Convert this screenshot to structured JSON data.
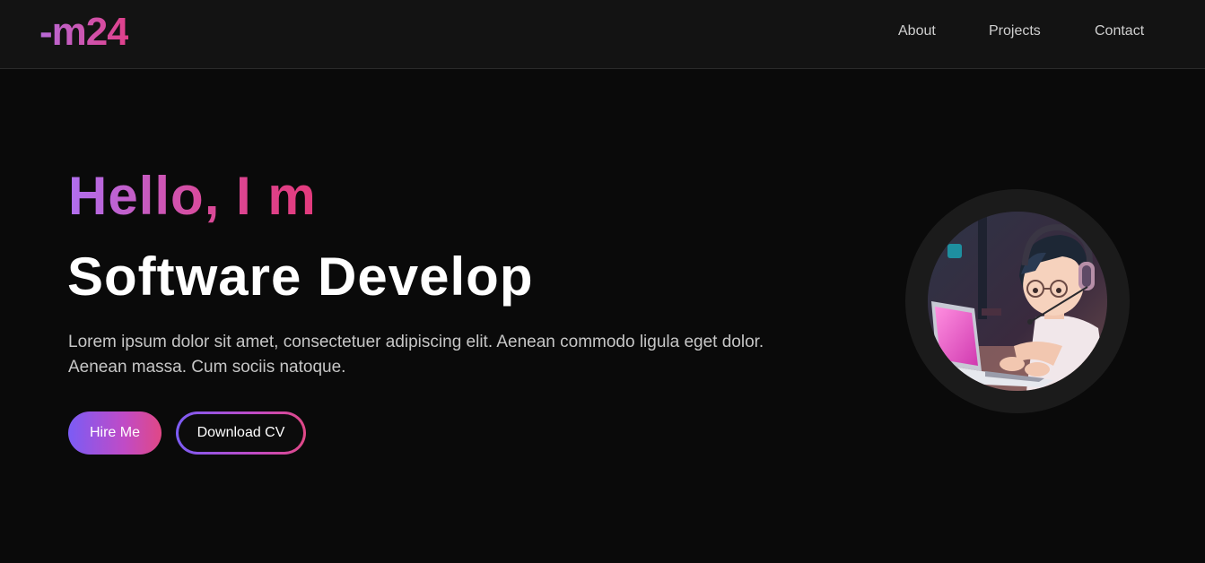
{
  "header": {
    "logo": "-m24",
    "nav": [
      "About",
      "Projects",
      "Contact"
    ]
  },
  "hero": {
    "greeting": "Hello, I m",
    "role": "Software Develop",
    "description": "Lorem ipsum dolor sit amet, consectetuer adipiscing elit. Aenean commodo ligula eget dolor. Aenean massa. Cum sociis natoque.",
    "hire_label": "Hire Me",
    "cv_label": "Download CV"
  },
  "colors": {
    "background": "#0a0a0a",
    "navbar": "#131313",
    "accent_purple": "#7b5cf5",
    "accent_pink": "#e04886"
  },
  "icons": {
    "avatar": "developer-avatar-illustration"
  }
}
